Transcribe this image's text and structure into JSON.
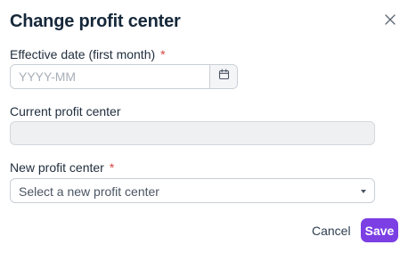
{
  "dialog": {
    "title": "Change profit center",
    "close_icon": "close-icon"
  },
  "effective_date": {
    "label": "Effective date (first month)",
    "required_marker": "*",
    "placeholder": "YYYY-MM",
    "value": "",
    "calendar_icon": "calendar-icon"
  },
  "current_profit_center": {
    "label": "Current profit center",
    "value": ""
  },
  "new_profit_center": {
    "label": "New profit center",
    "required_marker": "*",
    "selected_text": "Select a new profit center",
    "caret_icon": "caret-down-icon"
  },
  "actions": {
    "cancel_label": "Cancel",
    "save_label": "Save"
  },
  "colors": {
    "primary": "#7b3fe4",
    "required": "#d64545",
    "disabled_bg": "#eef0f2"
  }
}
